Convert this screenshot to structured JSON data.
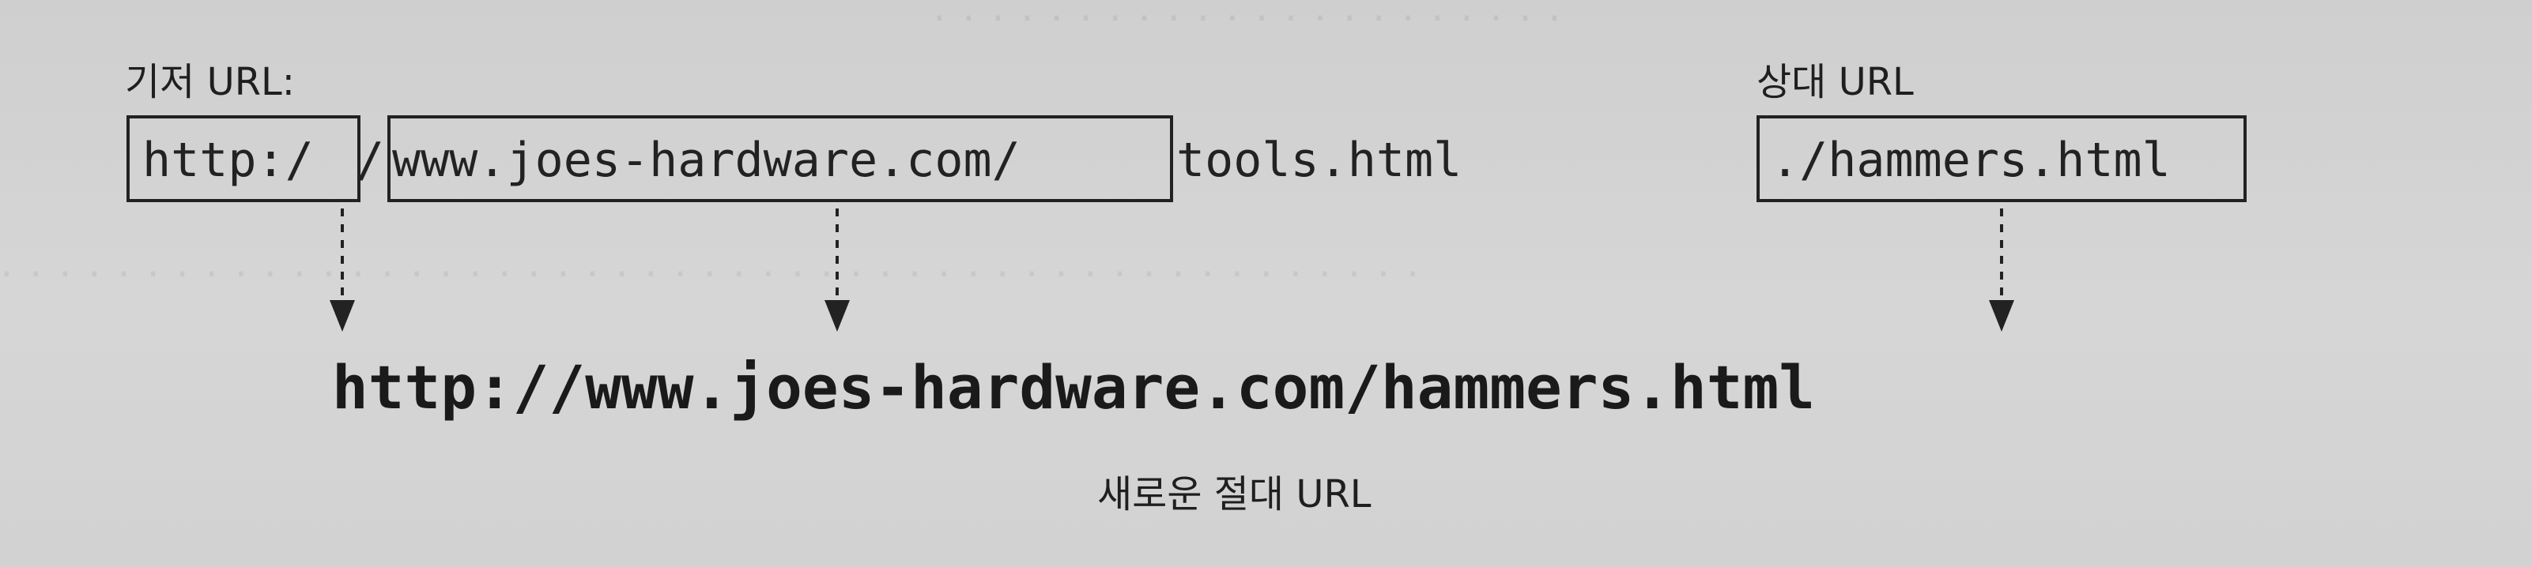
{
  "labels": {
    "base_url": "기저 URL:",
    "relative_url": "상대 URL",
    "new_absolute_url": "새로운 절대 URL"
  },
  "base_url_parts": {
    "scheme": "http:/",
    "separator": "/",
    "host": "www.joes-hardware.com/",
    "path": "tools.html"
  },
  "relative_url_value": "./hammers.html",
  "result_url": "http://www.joes-hardware.com/hammers.html",
  "colors": {
    "background": "#d2d2d2",
    "ink": "#222222"
  }
}
